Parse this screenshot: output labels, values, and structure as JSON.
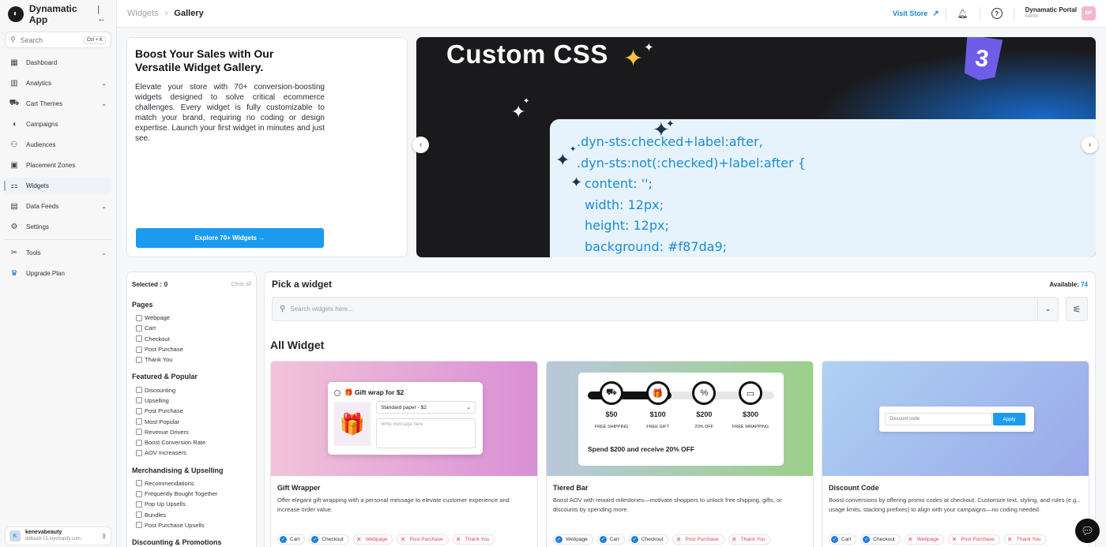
{
  "app": {
    "name": "Dynamatic App",
    "logo_icon": "logo-icon",
    "collapse_icon": "collapse-sidebar-icon"
  },
  "sidebar": {
    "search": {
      "placeholder": "Search",
      "shortcut": "Ctrl + K"
    },
    "items": [
      {
        "label": "Dashboard",
        "icon": "grid-icon",
        "glyph": "▦",
        "chevron": false
      },
      {
        "label": "Analytics",
        "icon": "chart-icon",
        "glyph": "▥",
        "chevron": true
      },
      {
        "label": "Cart Themes",
        "icon": "cart-icon",
        "glyph": "⛟",
        "chevron": true
      },
      {
        "label": "Campaigns",
        "icon": "megaphone-icon",
        "glyph": "◖",
        "chevron": false
      },
      {
        "label": "Audiences",
        "icon": "users-icon",
        "glyph": "⚇",
        "chevron": false
      },
      {
        "label": "Placement Zones",
        "icon": "placement-icon",
        "glyph": "▣",
        "chevron": false
      },
      {
        "label": "Widgets",
        "icon": "widgets-icon",
        "glyph": "⚏",
        "chevron": false,
        "active": true
      },
      {
        "label": "Data Feeds",
        "icon": "data-feeds-icon",
        "glyph": "▤",
        "chevron": true
      },
      {
        "label": "Settings",
        "icon": "gear-icon",
        "glyph": "⚙",
        "chevron": false
      }
    ],
    "secondary": [
      {
        "label": "Tools",
        "icon": "tools-icon",
        "glyph": "✂",
        "chevron": true
      },
      {
        "label": "Upgrade Plan",
        "icon": "crown-icon",
        "glyph": "♛",
        "chevron": false
      }
    ],
    "store": {
      "avatar": "K",
      "name": "kenevabeauty",
      "domain": "dd6aa9-15.myshopify.com"
    }
  },
  "header": {
    "breadcrumb": [
      "Widgets",
      "Gallery"
    ],
    "visit_store": "Visit Store",
    "portal_name": "Dynamatic Portal",
    "portal_role": "Admin",
    "avatar": "DP"
  },
  "hero": {
    "title": "Boost Your Sales with Our Versatile Widget Gallery.",
    "text": "Elevate your store with 70+ conversion-boosting widgets designed to solve critical ecommerce challenges. Every widget is fully customizable to match your brand, requiring no coding or design expertise. Launch your first widget in minutes and just see.",
    "button": "Explore 70+ Widgets →"
  },
  "carousel": {
    "title": "Custom CSS",
    "badge": "3",
    "code_lines": [
      ".dyn-sts:checked+label:after,",
      ".dyn-sts:not(:checked)+label:after {",
      "content: '';",
      "width: 12px;",
      "height: 12px;",
      "background: #f87da9;"
    ]
  },
  "filters": {
    "selected_label": "Selected :",
    "selected_count": "0",
    "clear": "Clear all",
    "groups": [
      {
        "title": "Pages",
        "options": [
          "Webpage",
          "Cart",
          "Checkout",
          "Post Purchase",
          "Thank You"
        ]
      },
      {
        "title": "Featured & Popular",
        "options": [
          "Discounting",
          "Upselling",
          "Post Purchase",
          "Most Popular",
          "Revenue Drivers",
          "Boost Conversion Rate",
          "AOV Increasers"
        ]
      },
      {
        "title": "Merchandising & Upselling",
        "options": [
          "Recommendations",
          "Frequently Bought Together",
          "Pop Up Upsells",
          "Bundles",
          "Post Purchase Upsells"
        ]
      },
      {
        "title": "Discounting & Promotions",
        "options": []
      }
    ]
  },
  "widgets": {
    "pick_title": "Pick a widget",
    "available_label": "Available:",
    "available_count": "74",
    "search_placeholder": "Search widgets here...",
    "section_title": "All Widget",
    "cards": [
      {
        "name": "Gift Wrapper",
        "description": "Offer elegant gift wrapping with a personal message to elevate customer experience and increase order value.",
        "tags": [
          {
            "label": "Cart",
            "on": true
          },
          {
            "label": "Checkout",
            "on": true
          },
          {
            "label": "Webpage",
            "on": false
          },
          {
            "label": "Post Purchase",
            "on": false
          },
          {
            "label": "Thank You",
            "on": false
          }
        ]
      },
      {
        "name": "Tiered Bar",
        "description": "Boost AOV with reward milestones—motivate shoppers to unlock free shipping, gifts, or discounts by spending more.",
        "tags": [
          {
            "label": "Webpage",
            "on": true
          },
          {
            "label": "Cart",
            "on": true
          },
          {
            "label": "Checkout",
            "on": true
          },
          {
            "label": "Post Purchase",
            "on": false
          },
          {
            "label": "Thank You",
            "on": false
          }
        ]
      },
      {
        "name": "Discount Code",
        "description": "Boost conversions by offering promo codes at checkout. Customize text, styling, and rules (e.g., usage limits, stacking prefixes) to align with your campaigns—no coding needed.",
        "tags": [
          {
            "label": "Cart",
            "on": true
          },
          {
            "label": "Checkout",
            "on": true
          },
          {
            "label": "Webpage",
            "on": false
          },
          {
            "label": "Post Purchase",
            "on": false
          },
          {
            "label": "Thank You",
            "on": false
          }
        ]
      }
    ],
    "previews": {
      "gift": {
        "title": "🎁 Gift wrap for $2",
        "select": "Standard paper - $2",
        "message_placeholder": "Write message here"
      },
      "tier": {
        "progress": 0.45,
        "milestones": [
          {
            "amount": "$50",
            "label": "FREE SHIPPING",
            "icon": "truck-icon",
            "glyph": "⛟"
          },
          {
            "amount": "$100",
            "label": "FREE GIFT",
            "icon": "gift-icon",
            "glyph": "🎁"
          },
          {
            "amount": "$200",
            "label": "20% OFF",
            "icon": "percent-icon",
            "glyph": "%"
          },
          {
            "amount": "$300",
            "label": "FREE WRAPPING",
            "icon": "wrap-icon",
            "glyph": "▭"
          }
        ],
        "caption": "Spend $200 and receive 20% OFF"
      },
      "discount": {
        "placeholder": "Discount code",
        "button": "Apply"
      }
    }
  },
  "colors": {
    "accent": "#1a9bef",
    "link": "#1a89d6",
    "dark": "#1a1a1c",
    "code": "#1c8cd4"
  }
}
